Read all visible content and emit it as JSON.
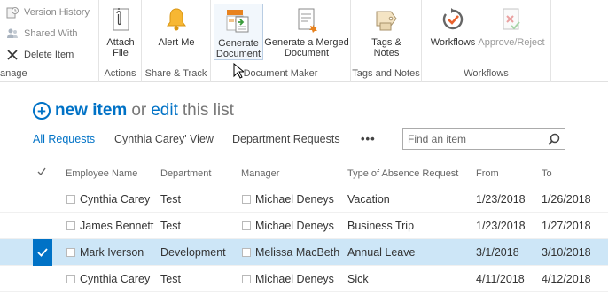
{
  "ribbon": {
    "groups": {
      "manage": {
        "label": "anage",
        "items": [
          {
            "label": "Version History",
            "icon": "version-history-icon"
          },
          {
            "label": "Shared With",
            "icon": "shared-with-icon"
          },
          {
            "label": "Delete Item",
            "icon": "delete-icon"
          }
        ]
      },
      "actions": {
        "label": "Actions",
        "attach": "Attach File"
      },
      "share_track": {
        "label": "Share & Track",
        "alert": "Alert Me"
      },
      "document_maker": {
        "label": "Document Maker",
        "generate": "Generate Document",
        "merged": "Generate a Merged Document"
      },
      "tags_notes": {
        "label": "Tags and Notes",
        "tags": "Tags & Notes"
      },
      "workflows": {
        "label": "Workflows",
        "workflows": "Workflows",
        "approve": "Approve/Reject"
      }
    }
  },
  "heading": {
    "new_item": "new item",
    "or": "or",
    "edit": "edit",
    "this_list": "this list"
  },
  "views": {
    "items": [
      "All Requests",
      "Cynthia Carey' View",
      "Department Requests"
    ],
    "more": "•••",
    "search_placeholder": "Find an item"
  },
  "table": {
    "columns": [
      "Employee Name",
      "Department",
      "Manager",
      "Type of Absence Request",
      "From",
      "To"
    ],
    "rows": [
      {
        "employee": "Cynthia Carey",
        "department": "Test",
        "manager": "Michael Deneys",
        "type": "Vacation",
        "from": "1/23/2018",
        "to": "1/26/2018",
        "selected": false
      },
      {
        "employee": "James Bennett",
        "department": "Test",
        "manager": "Michael Deneys",
        "type": "Business Trip",
        "from": "1/23/2018",
        "to": "1/27/2018",
        "selected": false
      },
      {
        "employee": "Mark Iverson",
        "department": "Development",
        "manager": "Melissa MacBeth",
        "type": "Annual Leave",
        "from": "3/1/2018",
        "to": "3/10/2018",
        "selected": true
      },
      {
        "employee": "Cynthia Carey",
        "department": "Test",
        "manager": "Michael Deneys",
        "type": "Sick",
        "from": "4/11/2018",
        "to": "4/12/2018",
        "selected": false
      }
    ]
  },
  "colors": {
    "accent": "#0072c6",
    "selected_row": "#cde6f7"
  }
}
